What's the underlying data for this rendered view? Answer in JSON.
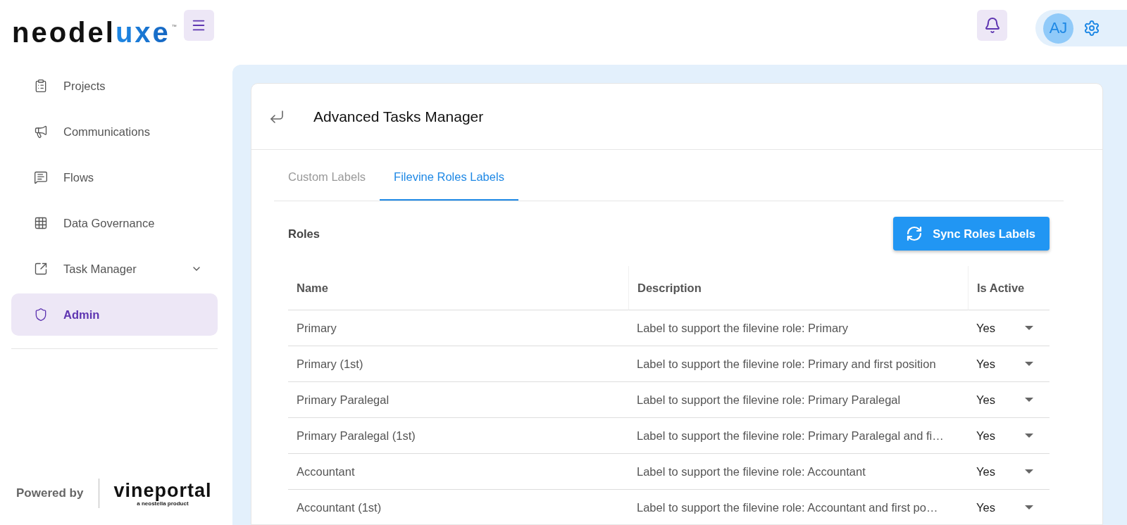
{
  "header": {
    "logo": {
      "dark": "neodel",
      "accent": "uxe",
      "mark": "™"
    },
    "avatar": "AJ"
  },
  "sidebar": {
    "items": [
      {
        "label": "Projects",
        "selected": false
      },
      {
        "label": "Communications",
        "selected": false
      },
      {
        "label": "Flows",
        "selected": false
      },
      {
        "label": "Data Governance",
        "selected": false
      },
      {
        "label": "Task Manager",
        "selected": false,
        "expandable": true
      },
      {
        "label": "Admin",
        "selected": true
      }
    ],
    "footer": {
      "powered_by": "Powered by",
      "brand": "vineportal",
      "tagline": "a neostella product"
    }
  },
  "page": {
    "title": "Advanced Tasks Manager",
    "tabs": [
      {
        "label": "Custom Labels",
        "selected": false
      },
      {
        "label": "Filevine Roles Labels",
        "selected": true
      }
    ],
    "section_title": "Roles",
    "sync_button": "Sync Roles Labels",
    "table": {
      "columns": [
        "Name",
        "Description",
        "Is Active"
      ],
      "rows": [
        {
          "name": "Primary",
          "description": "Label to support the filevine role: Primary",
          "is_active": "Yes"
        },
        {
          "name": "Primary (1st)",
          "description": "Label to support the filevine role: Primary and first position",
          "is_active": "Yes"
        },
        {
          "name": "Primary Paralegal",
          "description": "Label to support the filevine role: Primary Paralegal",
          "is_active": "Yes"
        },
        {
          "name": "Primary Paralegal (1st)",
          "description": "Label to support the filevine role: Primary Paralegal and fi…",
          "is_active": "Yes"
        },
        {
          "name": "Accountant",
          "description": "Label to support the filevine role: Accountant",
          "is_active": "Yes"
        },
        {
          "name": "Accountant (1st)",
          "description": "Label to support the filevine role: Accountant and first po…",
          "is_active": "Yes"
        }
      ]
    }
  }
}
